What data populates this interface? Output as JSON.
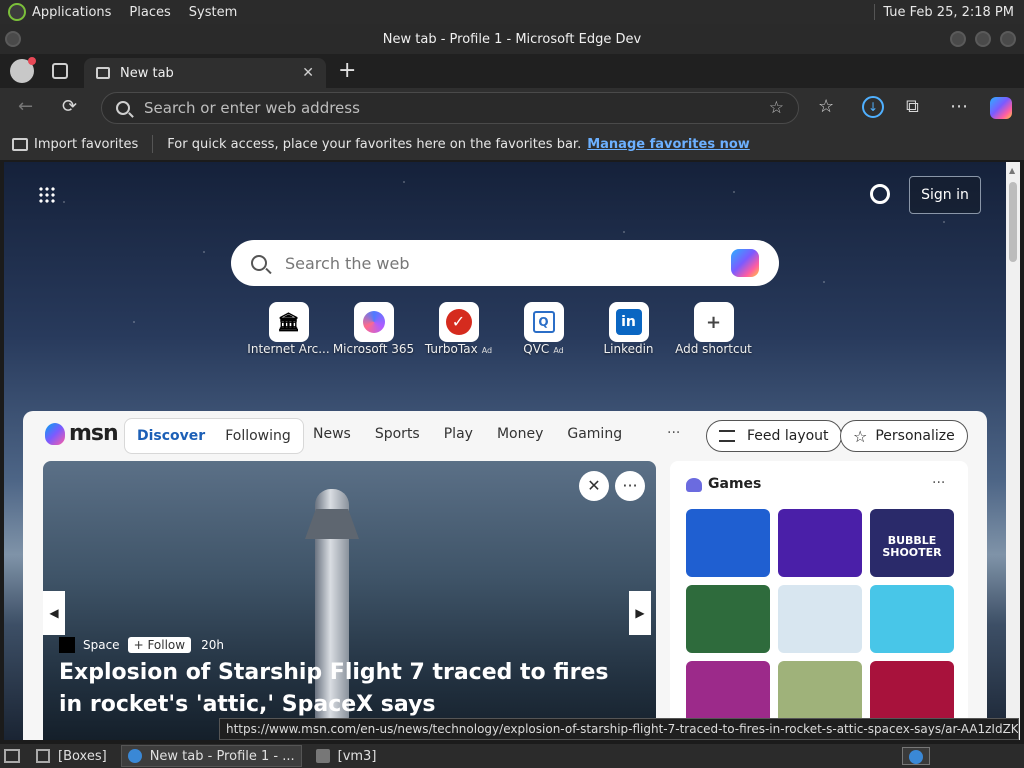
{
  "top_panel": {
    "menus": [
      "Applications",
      "Places",
      "System"
    ],
    "clock": "Tue Feb 25,  2:18 PM"
  },
  "window": {
    "title": "New tab - Profile 1 - Microsoft Edge Dev"
  },
  "tabs": [
    {
      "label": "New tab",
      "close": "✕"
    }
  ],
  "newtab_symbol": "+",
  "toolbar": {
    "address_placeholder": "Search or enter web address",
    "back": "←",
    "refresh": "⟳",
    "favorites": "☆",
    "collections": "⧉",
    "more": "⋯",
    "download": "↓"
  },
  "favorites_bar": {
    "import_label": "Import favorites",
    "hint": "For quick access, place your favorites here on the favorites bar.",
    "manage_link": "Manage favorites now"
  },
  "newtab": {
    "sign_in": "Sign in",
    "search_placeholder": "Search the web",
    "shortcuts": [
      {
        "label": "Internet Arc...",
        "ad": "",
        "icon": "🏛"
      },
      {
        "label": "Microsoft 365",
        "ad": "",
        "icon": ""
      },
      {
        "label": "TurboTax",
        "ad": "Ad",
        "icon": "✓"
      },
      {
        "label": "QVC",
        "ad": "Ad",
        "icon": "Q"
      },
      {
        "label": "Linkedin",
        "ad": "",
        "icon": "in"
      },
      {
        "label": "Add shortcut",
        "ad": "",
        "icon": "+"
      }
    ]
  },
  "feed": {
    "brand": "msn",
    "tabs": [
      {
        "label": "Discover",
        "active": true
      },
      {
        "label": "Following",
        "active": false
      }
    ],
    "nav": [
      "News",
      "Sports",
      "Play",
      "Money",
      "Gaming"
    ],
    "more": "···",
    "feed_layout": "Feed layout",
    "personalize": "Personalize",
    "hero": {
      "source": "Space",
      "follow": "+ Follow",
      "age": "20h",
      "headline": "Explosion of Starship Flight 7 traced to fires in rocket's 'attic,' SpaceX says",
      "close": "✕",
      "menu": "···",
      "prev": "◀",
      "next": "▶"
    },
    "games": {
      "title": "Games",
      "more": "···",
      "tiles": [
        {
          "name": "block-puzzle",
          "color": "#1f5fd1"
        },
        {
          "name": "arrow-game",
          "color": "#4a1fa8"
        },
        {
          "name": "bubble-shooter",
          "color": "#2a2a6a",
          "text": "BUBBLE SHOOTER"
        },
        {
          "name": "mahjong",
          "color": "#2e6b3c"
        },
        {
          "name": "stickman-thief",
          "color": "#d8e6f0"
        },
        {
          "name": "cube-character",
          "color": "#48c6e8"
        },
        {
          "name": "jewel-match",
          "color": "#9c2a8a"
        },
        {
          "name": "bunny-game",
          "color": "#9fb27a"
        },
        {
          "name": "block-fill",
          "color": "#a8123c"
        }
      ]
    }
  },
  "status_url": "https://www.msn.com/en-us/news/technology/explosion-of-starship-flight-7-traced-to-fires-in-rocket-s-attic-spacex-says/ar-AA1zIdZK",
  "taskbar": {
    "tasks": [
      {
        "label": "[Boxes]",
        "active": false
      },
      {
        "label": "New tab - Profile 1 - ...",
        "active": true
      },
      {
        "label": "[vm3]",
        "active": false
      }
    ]
  }
}
